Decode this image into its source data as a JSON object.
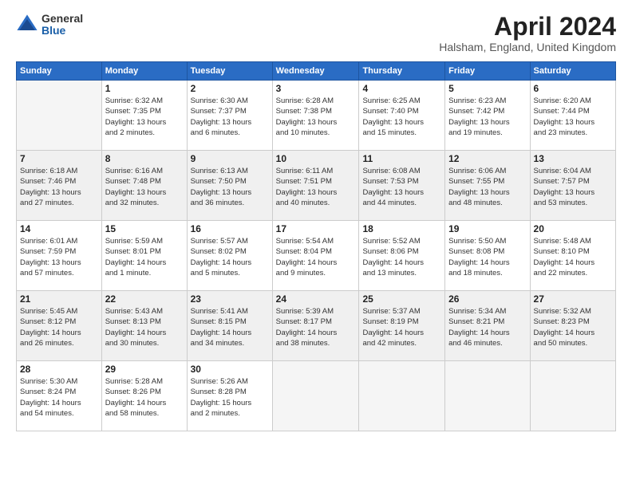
{
  "logo": {
    "general": "General",
    "blue": "Blue"
  },
  "title": "April 2024",
  "location": "Halsham, England, United Kingdom",
  "days_header": [
    "Sunday",
    "Monday",
    "Tuesday",
    "Wednesday",
    "Thursday",
    "Friday",
    "Saturday"
  ],
  "weeks": [
    [
      {
        "day": "",
        "detail": ""
      },
      {
        "day": "1",
        "detail": "Sunrise: 6:32 AM\nSunset: 7:35 PM\nDaylight: 13 hours\nand 2 minutes."
      },
      {
        "day": "2",
        "detail": "Sunrise: 6:30 AM\nSunset: 7:37 PM\nDaylight: 13 hours\nand 6 minutes."
      },
      {
        "day": "3",
        "detail": "Sunrise: 6:28 AM\nSunset: 7:38 PM\nDaylight: 13 hours\nand 10 minutes."
      },
      {
        "day": "4",
        "detail": "Sunrise: 6:25 AM\nSunset: 7:40 PM\nDaylight: 13 hours\nand 15 minutes."
      },
      {
        "day": "5",
        "detail": "Sunrise: 6:23 AM\nSunset: 7:42 PM\nDaylight: 13 hours\nand 19 minutes."
      },
      {
        "day": "6",
        "detail": "Sunrise: 6:20 AM\nSunset: 7:44 PM\nDaylight: 13 hours\nand 23 minutes."
      }
    ],
    [
      {
        "day": "7",
        "detail": "Sunrise: 6:18 AM\nSunset: 7:46 PM\nDaylight: 13 hours\nand 27 minutes."
      },
      {
        "day": "8",
        "detail": "Sunrise: 6:16 AM\nSunset: 7:48 PM\nDaylight: 13 hours\nand 32 minutes."
      },
      {
        "day": "9",
        "detail": "Sunrise: 6:13 AM\nSunset: 7:50 PM\nDaylight: 13 hours\nand 36 minutes."
      },
      {
        "day": "10",
        "detail": "Sunrise: 6:11 AM\nSunset: 7:51 PM\nDaylight: 13 hours\nand 40 minutes."
      },
      {
        "day": "11",
        "detail": "Sunrise: 6:08 AM\nSunset: 7:53 PM\nDaylight: 13 hours\nand 44 minutes."
      },
      {
        "day": "12",
        "detail": "Sunrise: 6:06 AM\nSunset: 7:55 PM\nDaylight: 13 hours\nand 48 minutes."
      },
      {
        "day": "13",
        "detail": "Sunrise: 6:04 AM\nSunset: 7:57 PM\nDaylight: 13 hours\nand 53 minutes."
      }
    ],
    [
      {
        "day": "14",
        "detail": "Sunrise: 6:01 AM\nSunset: 7:59 PM\nDaylight: 13 hours\nand 57 minutes."
      },
      {
        "day": "15",
        "detail": "Sunrise: 5:59 AM\nSunset: 8:01 PM\nDaylight: 14 hours\nand 1 minute."
      },
      {
        "day": "16",
        "detail": "Sunrise: 5:57 AM\nSunset: 8:02 PM\nDaylight: 14 hours\nand 5 minutes."
      },
      {
        "day": "17",
        "detail": "Sunrise: 5:54 AM\nSunset: 8:04 PM\nDaylight: 14 hours\nand 9 minutes."
      },
      {
        "day": "18",
        "detail": "Sunrise: 5:52 AM\nSunset: 8:06 PM\nDaylight: 14 hours\nand 13 minutes."
      },
      {
        "day": "19",
        "detail": "Sunrise: 5:50 AM\nSunset: 8:08 PM\nDaylight: 14 hours\nand 18 minutes."
      },
      {
        "day": "20",
        "detail": "Sunrise: 5:48 AM\nSunset: 8:10 PM\nDaylight: 14 hours\nand 22 minutes."
      }
    ],
    [
      {
        "day": "21",
        "detail": "Sunrise: 5:45 AM\nSunset: 8:12 PM\nDaylight: 14 hours\nand 26 minutes."
      },
      {
        "day": "22",
        "detail": "Sunrise: 5:43 AM\nSunset: 8:13 PM\nDaylight: 14 hours\nand 30 minutes."
      },
      {
        "day": "23",
        "detail": "Sunrise: 5:41 AM\nSunset: 8:15 PM\nDaylight: 14 hours\nand 34 minutes."
      },
      {
        "day": "24",
        "detail": "Sunrise: 5:39 AM\nSunset: 8:17 PM\nDaylight: 14 hours\nand 38 minutes."
      },
      {
        "day": "25",
        "detail": "Sunrise: 5:37 AM\nSunset: 8:19 PM\nDaylight: 14 hours\nand 42 minutes."
      },
      {
        "day": "26",
        "detail": "Sunrise: 5:34 AM\nSunset: 8:21 PM\nDaylight: 14 hours\nand 46 minutes."
      },
      {
        "day": "27",
        "detail": "Sunrise: 5:32 AM\nSunset: 8:23 PM\nDaylight: 14 hours\nand 50 minutes."
      }
    ],
    [
      {
        "day": "28",
        "detail": "Sunrise: 5:30 AM\nSunset: 8:24 PM\nDaylight: 14 hours\nand 54 minutes."
      },
      {
        "day": "29",
        "detail": "Sunrise: 5:28 AM\nSunset: 8:26 PM\nDaylight: 14 hours\nand 58 minutes."
      },
      {
        "day": "30",
        "detail": "Sunrise: 5:26 AM\nSunset: 8:28 PM\nDaylight: 15 hours\nand 2 minutes."
      },
      {
        "day": "",
        "detail": ""
      },
      {
        "day": "",
        "detail": ""
      },
      {
        "day": "",
        "detail": ""
      },
      {
        "day": "",
        "detail": ""
      }
    ]
  ]
}
